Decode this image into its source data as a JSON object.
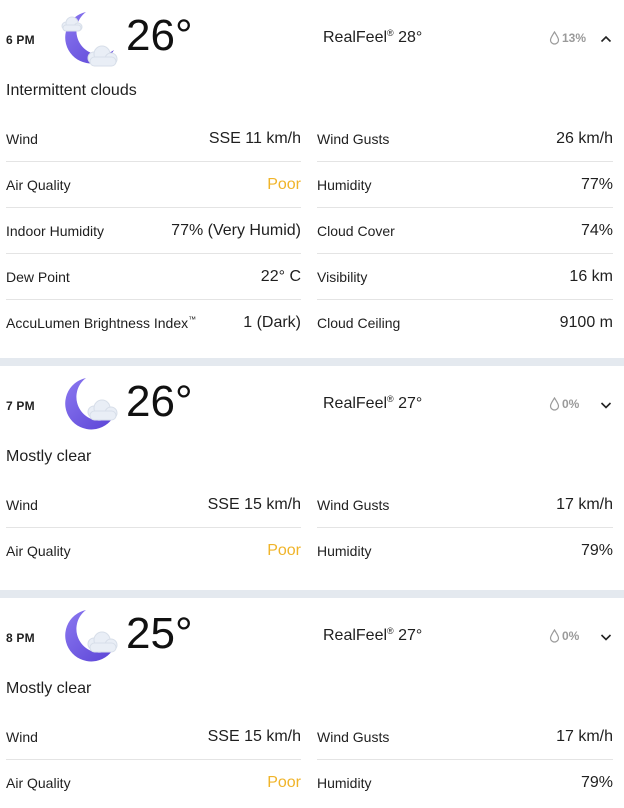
{
  "hours": [
    {
      "time": "6 PM",
      "icon": "moon-cloud-icon",
      "temp": "26°",
      "realfeel_label": "RealFeel",
      "realfeel_mark": "®",
      "realfeel_value": " 28°",
      "precip": "13%",
      "expanded": true,
      "phrase": "Intermittent clouds",
      "left": [
        {
          "label": "Wind",
          "value": "SSE 11 km/h"
        },
        {
          "label": "Air Quality",
          "value": "Poor"
        },
        {
          "label": "Indoor Humidity",
          "value": "77% (Very Humid)"
        },
        {
          "label": "Dew Point",
          "value": "22° C"
        },
        {
          "label": "AccuLumen Brightness Index",
          "label_mark": "™",
          "value": "1 (Dark)"
        }
      ],
      "right": [
        {
          "label": "Wind Gusts",
          "value": "26 km/h"
        },
        {
          "label": "Humidity",
          "value": "77%"
        },
        {
          "label": "Cloud Cover",
          "value": "74%"
        },
        {
          "label": "Visibility",
          "value": "16 km"
        },
        {
          "label": "Cloud Ceiling",
          "value": "9100 m"
        }
      ]
    },
    {
      "time": "7 PM",
      "icon": "moon-cloud-icon",
      "temp": "26°",
      "realfeel_label": "RealFeel",
      "realfeel_mark": "®",
      "realfeel_value": " 27°",
      "precip": "0%",
      "expanded": false,
      "phrase": "Mostly clear",
      "left": [
        {
          "label": "Wind",
          "value": "SSE 15 km/h"
        },
        {
          "label": "Air Quality",
          "value": "Poor"
        }
      ],
      "right": [
        {
          "label": "Wind Gusts",
          "value": "17 km/h"
        },
        {
          "label": "Humidity",
          "value": "79%"
        }
      ]
    },
    {
      "time": "8 PM",
      "icon": "moon-cloud-icon",
      "temp": "25°",
      "realfeel_label": "RealFeel",
      "realfeel_mark": "®",
      "realfeel_value": " 27°",
      "precip": "0%",
      "expanded": false,
      "phrase": "Mostly clear",
      "left": [
        {
          "label": "Wind",
          "value": "SSE 15 km/h"
        },
        {
          "label": "Air Quality",
          "value": "Poor"
        }
      ],
      "right": [
        {
          "label": "Wind Gusts",
          "value": "17 km/h"
        },
        {
          "label": "Humidity",
          "value": "79%"
        }
      ]
    }
  ],
  "colors": {
    "poor": "#f0b42a",
    "moon": "#6b55e0",
    "separator": "#e4e9ef",
    "precip_text": "#9a9a9a"
  }
}
